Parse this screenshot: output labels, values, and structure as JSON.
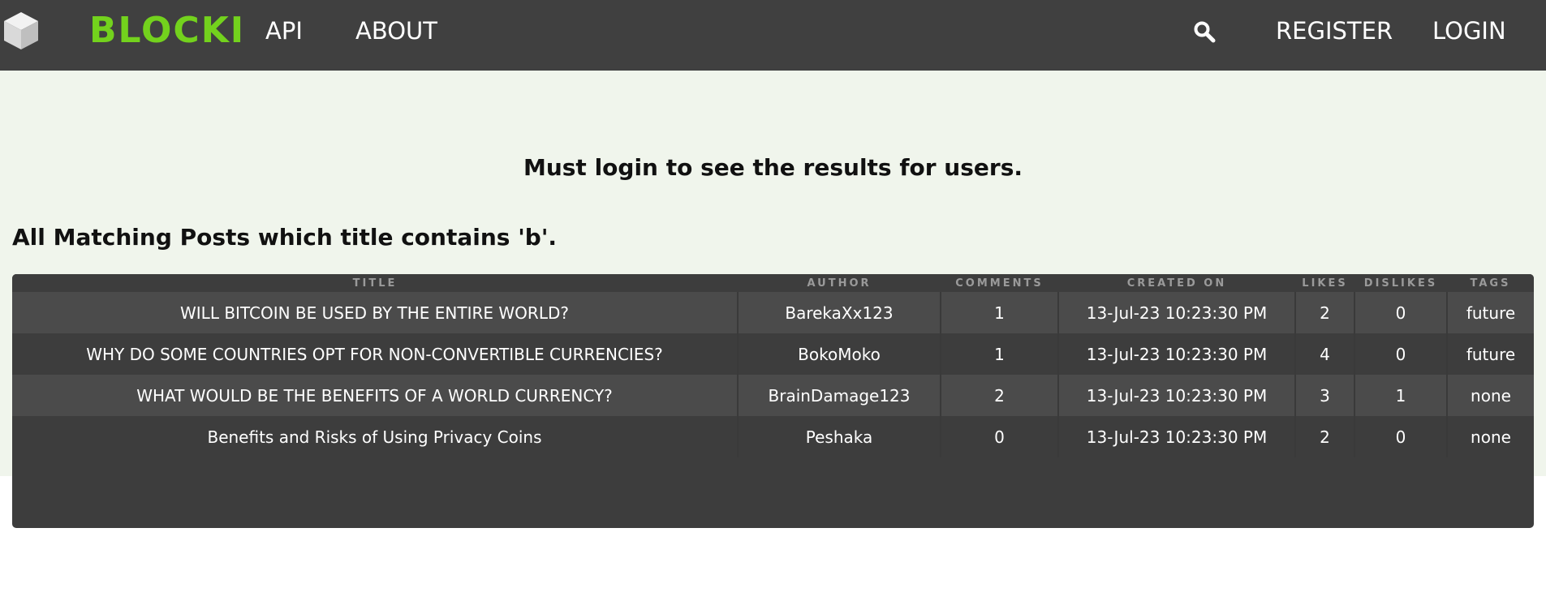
{
  "nav": {
    "logo": "BLOCKI",
    "api": "API",
    "about": "ABOUT",
    "register": "REGISTER",
    "login": "LOGIN",
    "icons": [
      "cube-logo-icon",
      "search-icon"
    ]
  },
  "colors": {
    "navbar_bg": "#404040",
    "logo_green": "#73d21d",
    "content_bg": "#f0f5ec",
    "table_bg": "#3d3d3d",
    "row_light": "#4b4b4b"
  },
  "main": {
    "login_message": "Must login to see the results for users.",
    "results_heading": "All Matching Posts which title contains 'b'."
  },
  "table": {
    "headers": {
      "title": "TITLE",
      "author": "AUTHOR",
      "comments": "COMMENTS",
      "created_on": "CREATED ON",
      "likes": "LIKES",
      "dislikes": "DISLIKES",
      "tags": "TAGS"
    },
    "rows": [
      {
        "title": "WILL BITCOIN BE USED BY THE ENTIRE WORLD?",
        "author": "BarekaXx123",
        "comments": "1",
        "created_on": "13-Jul-23 10:23:30 PM",
        "likes": "2",
        "dislikes": "0",
        "tags": "future"
      },
      {
        "title": "WHY DO SOME COUNTRIES OPT FOR NON-CONVERTIBLE CURRENCIES?",
        "author": "BokoMoko",
        "comments": "1",
        "created_on": "13-Jul-23 10:23:30 PM",
        "likes": "4",
        "dislikes": "0",
        "tags": "future"
      },
      {
        "title": "WHAT WOULD BE THE BENEFITS OF A WORLD CURRENCY?",
        "author": "BrainDamage123",
        "comments": "2",
        "created_on": "13-Jul-23 10:23:30 PM",
        "likes": "3",
        "dislikes": "1",
        "tags": "none"
      },
      {
        "title": "Benefits and Risks of Using Privacy Coins",
        "author": "Peshaka",
        "comments": "0",
        "created_on": "13-Jul-23 10:23:30 PM",
        "likes": "2",
        "dislikes": "0",
        "tags": "none"
      }
    ]
  }
}
